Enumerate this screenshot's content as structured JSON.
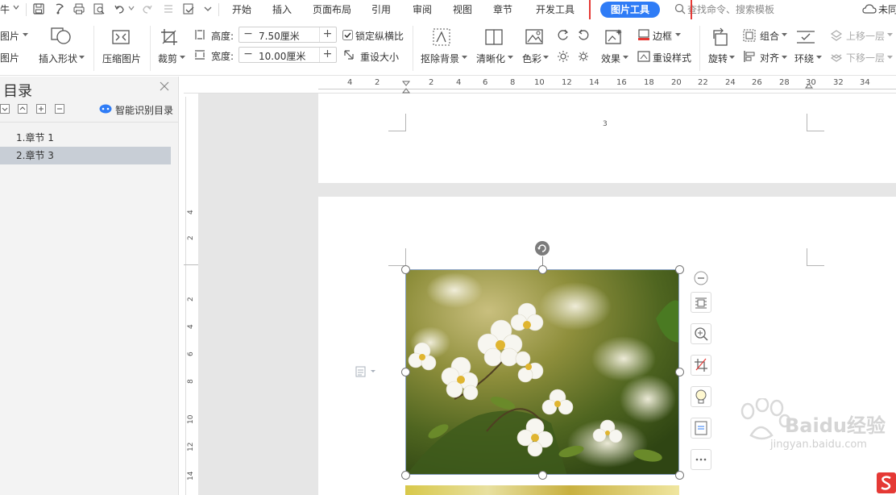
{
  "menubar": {
    "tabs": [
      "开始",
      "插入",
      "页面布局",
      "引用",
      "审阅",
      "视图",
      "章节",
      "开发工具"
    ],
    "active_tab": "图片工具",
    "search_placeholder": "查找命令、搜索模板",
    "sync_label": "未同",
    "file_label": "牛"
  },
  "ribbon": {
    "insert_picture_top": "图片",
    "insert_picture_bottom": "图片",
    "insert_shape": "插入形状",
    "compress_picture": "压缩图片",
    "crop": "裁剪",
    "height_label": "高度:",
    "height_value": "7.50厘米",
    "width_label": "宽度:",
    "width_value": "10.00厘米",
    "lock_ratio": "锁定纵横比",
    "reset_size": "重设大小",
    "remove_bg": "抠除背景",
    "sharpen": "清晰化",
    "color": "色彩",
    "effects": "效果",
    "border": "边框",
    "reset_style": "重设样式",
    "rotate": "旋转",
    "group": "组合",
    "align": "对齐",
    "wrap": "环绕",
    "bring_forward": "上移一层",
    "send_backward": "下移一层"
  },
  "toc": {
    "title": "目录",
    "smart_toc": "智能识别目录",
    "items": [
      "1.章节 1",
      "2.章节 3"
    ]
  },
  "ruler": {
    "h_ticks": [
      "4",
      "2",
      "2",
      "4",
      "6",
      "8",
      "10",
      "12",
      "14",
      "16",
      "18",
      "20",
      "22",
      "24",
      "26",
      "28",
      "30",
      "32",
      "34"
    ],
    "v_ticks": [
      "4",
      "2",
      "2",
      "4",
      "6",
      "8",
      "10",
      "12",
      "14"
    ]
  },
  "document": {
    "page_number": "3"
  },
  "watermark": {
    "brand": "Baidu经验",
    "url": "jingyan.baidu.com"
  },
  "colors": {
    "accent": "#2f7cf6",
    "highlight": "#e53935"
  }
}
